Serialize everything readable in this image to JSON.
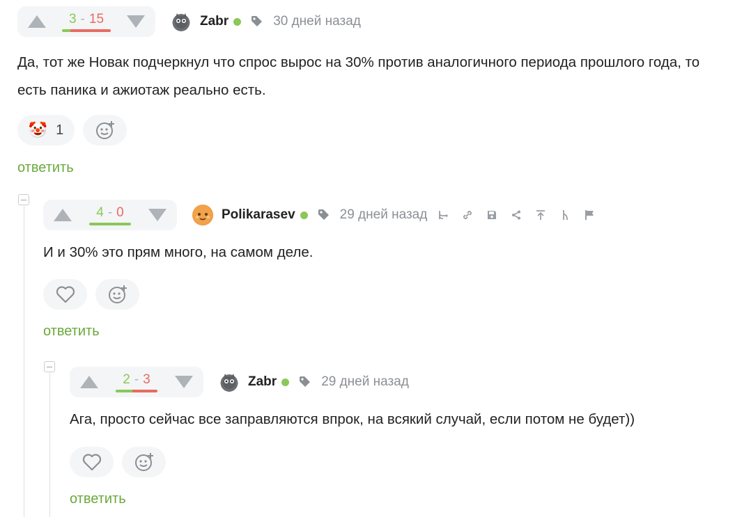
{
  "comments": [
    {
      "score": {
        "plus": "3",
        "minus": "15",
        "plus_ratio": 0.17
      },
      "author": "Zabr",
      "time": "30 дней назад",
      "text": "Да, тот же Новак подчеркнул что спрос вырос на 30% против аналогичного периода прошлого года, то есть паника и ажиотаж реально есть.",
      "reaction": {
        "emoji": "🤡",
        "count": "1"
      },
      "reply_label": "ответить"
    },
    {
      "score": {
        "plus": "4",
        "minus": "0",
        "plus_ratio": 1.0
      },
      "author": "Polikarasev",
      "time": "29 дней назад",
      "text": "И и 30% это прям много, на самом деле.",
      "reply_label": "ответить"
    },
    {
      "score": {
        "plus": "2",
        "minus": "3",
        "plus_ratio": 0.4
      },
      "author": "Zabr",
      "time": "29 дней назад",
      "text": "Ага, просто сейчас все заправляются впрок, на всякий случай, если потом не будет))",
      "reply_label": "ответить"
    }
  ],
  "colors": {
    "positive": "#8ac858",
    "negative": "#e86b62",
    "reply_link": "#6aa83d",
    "muted": "#8b8f94"
  },
  "icons": {
    "vote_up": "triangle-up-icon",
    "vote_down": "triangle-down-icon",
    "tag": "tag-icon",
    "online": "online-dot-icon",
    "add_reaction": "smiley-plus-icon",
    "like": "heart-icon",
    "actions": [
      "branch-icon",
      "link-icon",
      "save-icon",
      "share-icon",
      "scroll-up-icon",
      "parent-icon",
      "flag-icon"
    ]
  }
}
